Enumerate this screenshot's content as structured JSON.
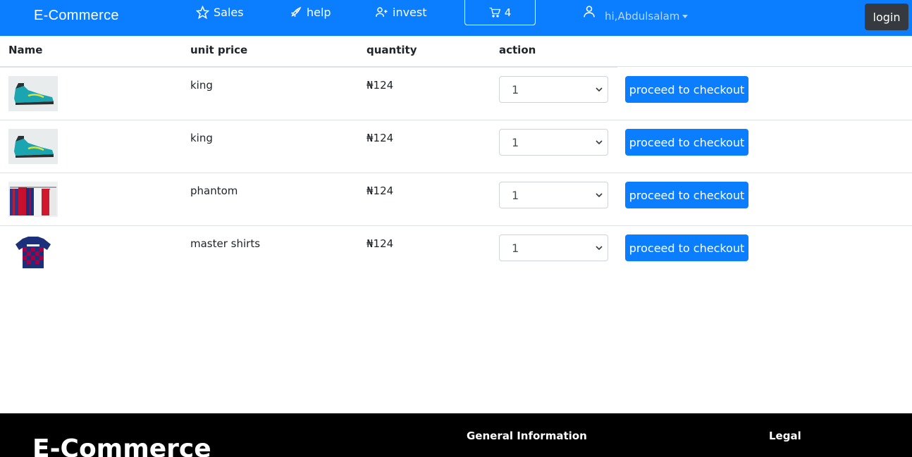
{
  "navbar": {
    "brand": "E-Commerce",
    "sales_label": "Sales",
    "help_label": "help",
    "invest_label": "invest",
    "cart_count": "4",
    "user_label": "hi,Abdulsalam",
    "login_label": "login",
    "colors": {
      "bg": "#0b7eff",
      "login_bg": "#343a40"
    }
  },
  "table": {
    "headers": {
      "name": "Name",
      "unit_price": "unit price",
      "quantity": "quantity",
      "action": "action"
    },
    "rows": [
      {
        "name": "king",
        "price": "₦124",
        "quantity": "1",
        "action": "proceed to checkout",
        "thumbnail": "boot-thumbnail"
      },
      {
        "name": "king",
        "price": "₦124",
        "quantity": "1",
        "action": "proceed to checkout",
        "thumbnail": "boot-thumbnail"
      },
      {
        "name": "phantom",
        "price": "₦124",
        "quantity": "1",
        "action": "proceed to checkout",
        "thumbnail": "jerseys-thumbnail"
      },
      {
        "name": "master shirts",
        "price": "₦124",
        "quantity": "1",
        "action": "proceed to checkout",
        "thumbnail": "shirt-thumbnail"
      }
    ]
  },
  "footer": {
    "brand": "E-Commerce",
    "general_info": "General Information",
    "legal": "Legal"
  }
}
